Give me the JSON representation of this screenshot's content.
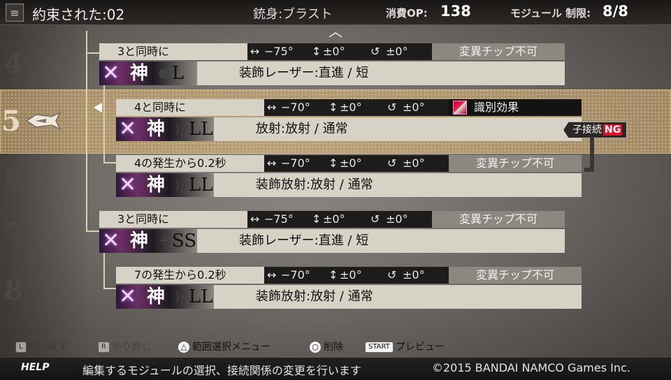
{
  "header": {
    "menu_icon": "list-icon",
    "title": "約束された:02",
    "gun_label": "銃身:ブラスト",
    "op_label": "消費OP:",
    "op_value": "138",
    "module_label": "モジュール 制限:",
    "module_value": "8/8"
  },
  "row_numbers": [
    "4",
    "5",
    "6",
    "7",
    "8"
  ],
  "selected_row": "5",
  "modules": [
    {
      "cond": "3と同時に",
      "yaw": "−75°",
      "pitch": "±0°",
      "roll": "±0°",
      "chip": "変異チップ不可",
      "bullet_mark": "神",
      "bullet_shape": "●",
      "bullet_size": "L",
      "desc": "装飾レーザー:直進 / 短"
    },
    {
      "cond": "4と同時に",
      "yaw": "−70°",
      "pitch": "±0°",
      "roll": "±0°",
      "chip": "識別効果",
      "bullet_mark": "神",
      "bullet_shape": ")",
      "bullet_size": "LL",
      "desc": "放射:放射 / 通常"
    },
    {
      "cond": "4の発生から0.2秒",
      "yaw": "−70°",
      "pitch": "±0°",
      "roll": "±0°",
      "chip": "変異チップ不可",
      "bullet_mark": "神",
      "bullet_shape": ")",
      "bullet_size": "LL",
      "desc": "装飾放射:放射 / 通常"
    },
    {
      "cond": "3と同時に",
      "yaw": "−75°",
      "pitch": "±0°",
      "roll": "±0°",
      "chip": "変異チップ不可",
      "bullet_mark": "神",
      "bullet_shape": "+",
      "bullet_size": "SS",
      "desc": "装飾レーザー:直進 / 短"
    },
    {
      "cond": "7の発生から0.2秒",
      "yaw": "−70°",
      "pitch": "±0°",
      "roll": "±0°",
      "chip": "変異チップ不可",
      "bullet_mark": "神",
      "bullet_shape": ")",
      "bullet_size": "LL",
      "desc": "装飾放射:放射 / 通常"
    }
  ],
  "ng_badge": {
    "label": "子接続",
    "ng": "NG"
  },
  "footer": {
    "undo_btn": "L",
    "undo": "元に戻す",
    "redo_btn": "R",
    "redo": "やり直し",
    "menu_btn": "△",
    "menu": "範囲選択メニュー",
    "delete_btn": "○",
    "delete": "削除",
    "preview_btn": "START",
    "preview": "プレビュー"
  },
  "help": {
    "tag": "HELP",
    "text": "編集するモジュールの選択、接続関係の変更を行います",
    "copyright": "©2015 BANDAI NAMCO Games Inc."
  }
}
